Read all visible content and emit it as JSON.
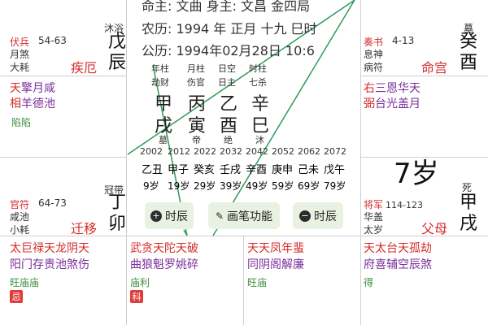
{
  "center": {
    "line1": "命主: 文曲  身主: 文昌  金四局",
    "line2": "农历: 1994 年 正月 十九 巳时",
    "line3": "公历: 1994年02月28日 10:6",
    "pillars": [
      {
        "title": "年柱",
        "sub": "劫财",
        "stem": "甲",
        "branch": "戌",
        "phase": "墓"
      },
      {
        "title": "月柱",
        "sub": "伤官",
        "stem": "丙",
        "branch": "寅",
        "phase": "帝"
      },
      {
        "title": "日空",
        "sub": "日主",
        "stem": "乙",
        "branch": "酉",
        "phase": "绝"
      },
      {
        "title": "时柱",
        "sub": "七杀",
        "stem": "辛",
        "branch": "巳",
        "phase": "沐"
      }
    ],
    "years": [
      "2002",
      "2012",
      "2022",
      "2032",
      "2042",
      "2052",
      "2062",
      "2072"
    ],
    "year_gz": [
      "乙丑",
      "甲子",
      "癸亥",
      "壬戌",
      "辛酉",
      "庚申",
      "己未",
      "戊午"
    ],
    "ages": [
      "9岁",
      "19岁",
      "29岁",
      "39岁",
      "49岁",
      "59岁",
      "69岁",
      "79岁"
    ],
    "age_big": "7岁",
    "buttons": [
      "时辰",
      "画笔功能",
      "时辰"
    ]
  },
  "palaces": {
    "top_left": {
      "god": "伏兵",
      "range": "54-63",
      "s1": "月煞",
      "s2": "大耗",
      "phase": "沐浴",
      "stem": "戊",
      "branch": "辰",
      "name": "疾厄"
    },
    "top_right": {
      "god": "奏书",
      "range": "4-13",
      "s1": "息神",
      "s2": "病符",
      "phase": "墓",
      "stem": "癸",
      "branch": "酉",
      "name": "命宫"
    },
    "mid_left_top": {
      "row1a": "天",
      "row1b": "擎月咸",
      "row2a": "相",
      "row2b": "羊德池",
      "row3": "陷陷"
    },
    "mid_left_bottom": {
      "god": "官符",
      "range": "64-73",
      "s1": "咸池",
      "s2": "小耗",
      "phase": "冠带",
      "stem": "丁",
      "branch": "卯",
      "name": "迁移"
    },
    "mid_right_top": {
      "row1a": "右",
      "row1b": "三恩华天",
      "row2a": "弼",
      "row2b": "台光盖月"
    },
    "mid_right_bottom": {
      "god": "将军",
      "range": "114-123",
      "s1": "华盖",
      "s2": "太岁",
      "phase": "死",
      "stem": "甲",
      "branch": "戌",
      "name": "父母"
    },
    "bottom": [
      {
        "row1": "太巨禄天龙阴天",
        "row2": "阳门存贵池煞伤",
        "row3": "旺庙庙",
        "tag": "忌"
      },
      {
        "row1": "武贪天陀天破",
        "row2": "曲狼魁罗姚碎",
        "row3": "庙利",
        "tag": "科"
      },
      {
        "row1": "天天凤年蜚",
        "row2": "同阴阁解廉",
        "row3": "旺庙"
      },
      {
        "row1": "天太台天孤劫",
        "row2": "府喜辅空辰煞",
        "row3": "得"
      }
    ]
  },
  "colors": {
    "red": "#d52b2b",
    "purple": "#7a2e9a",
    "green": "#3a8a3a",
    "line": "#2f9a5a",
    "button_bg": "#e9f2e2"
  }
}
